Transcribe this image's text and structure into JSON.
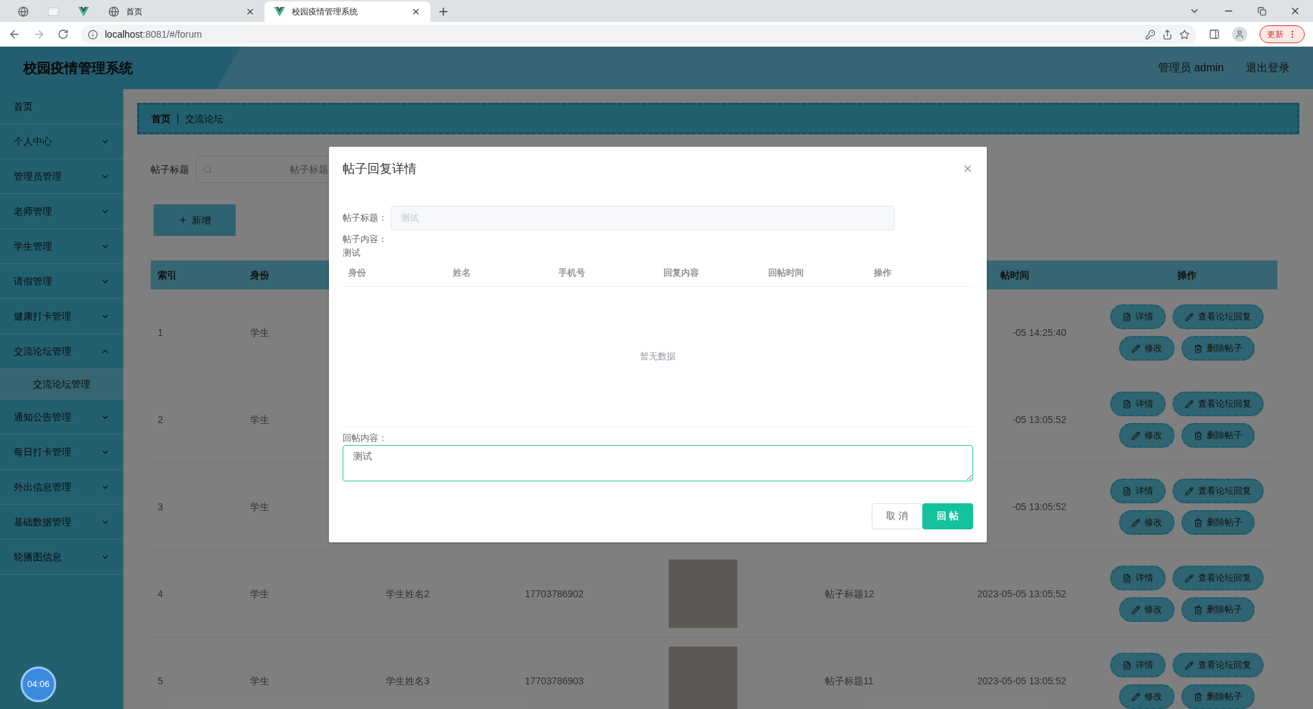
{
  "browser": {
    "tabs": [
      {
        "kind": "globe",
        "selected": false
      },
      {
        "kind": "page",
        "selected": false
      },
      {
        "kind": "vue",
        "selected": false
      },
      {
        "kind": "globe",
        "title": "首页",
        "selected": false
      },
      {
        "kind": "vue",
        "title": "校园疫情管理系统",
        "selected": true
      }
    ],
    "url_host": "localhost",
    "url_rest": ":8081/#/forum",
    "update_button": "更新"
  },
  "header": {
    "title": "校园疫情管理系统",
    "user": "管理员 admin",
    "logout": "退出登录"
  },
  "sidebar": {
    "items": [
      {
        "label": "首页",
        "kind": "link"
      },
      {
        "label": "个人中心",
        "kind": "menu",
        "expanded": false
      },
      {
        "label": "管理员管理",
        "kind": "menu",
        "expanded": false
      },
      {
        "label": "老师管理",
        "kind": "menu",
        "expanded": false
      },
      {
        "label": "学生管理",
        "kind": "menu",
        "expanded": false
      },
      {
        "label": "请假管理",
        "kind": "menu",
        "expanded": false
      },
      {
        "label": "健康打卡管理",
        "kind": "menu",
        "expanded": false
      },
      {
        "label": "交流论坛管理",
        "kind": "menu",
        "expanded": true,
        "children": [
          {
            "label": "交流论坛管理",
            "selected": true
          }
        ]
      },
      {
        "label": "通知公告管理",
        "kind": "menu",
        "expanded": false
      },
      {
        "label": "每日打卡管理",
        "kind": "menu",
        "expanded": false
      },
      {
        "label": "外出信息管理",
        "kind": "menu",
        "expanded": false
      },
      {
        "label": "基础数据管理",
        "kind": "menu",
        "expanded": false
      },
      {
        "label": "轮播图信息",
        "kind": "menu",
        "expanded": false
      }
    ]
  },
  "breadcrumb": [
    "首页",
    "交流论坛"
  ],
  "search": {
    "label": "帖子标题",
    "placeholder": "帖子标题"
  },
  "add_button": "新增",
  "table": {
    "header": {
      "index": "索引",
      "identity": "身份",
      "time": "帖时间",
      "actions": "操作"
    },
    "rows": [
      {
        "index": "1",
        "identity": "学生",
        "time": "-05 14:25:40",
        "actions": [
          {
            "label": "详情",
            "kind": "doc"
          },
          {
            "label": "查看论坛回复",
            "kind": "pencil"
          },
          {
            "label": "修改",
            "kind": "pencil"
          },
          {
            "label": "删除帖子",
            "kind": "trash"
          }
        ]
      },
      {
        "index": "2",
        "identity": "学生",
        "time": "-05 13:05:52",
        "actions": [
          {
            "label": "详情",
            "kind": "doc"
          },
          {
            "label": "查看论坛回复",
            "kind": "pencil"
          },
          {
            "label": "修改",
            "kind": "pencil"
          },
          {
            "label": "删除帖子",
            "kind": "trash"
          }
        ]
      },
      {
        "index": "3",
        "identity": "学生",
        "time": "-05 13:05:52",
        "actions": [
          {
            "label": "详情",
            "kind": "doc"
          },
          {
            "label": "查看论坛回复",
            "kind": "pencil"
          },
          {
            "label": "修改",
            "kind": "pencil"
          },
          {
            "label": "删除帖子",
            "kind": "trash"
          }
        ]
      },
      {
        "index": "4",
        "identity": "学生",
        "name": "学生姓名2",
        "phone": "17703786902",
        "photo": true,
        "title": "帖子标题12",
        "time": "2023-05-05 13:05:52",
        "actions": [
          {
            "label": "详情",
            "kind": "doc"
          },
          {
            "label": "查看论坛回复",
            "kind": "pencil"
          },
          {
            "label": "修改",
            "kind": "pencil"
          },
          {
            "label": "删除帖子",
            "kind": "trash"
          }
        ]
      },
      {
        "index": "5",
        "identity": "学生",
        "name": "学生姓名3",
        "phone": "17703786903",
        "photo": true,
        "title": "帖子标题11",
        "time": "2023-05-05 13:05:52",
        "actions": [
          {
            "label": "详情",
            "kind": "doc"
          },
          {
            "label": "查看论坛回复",
            "kind": "pencil"
          },
          {
            "label": "修改",
            "kind": "pencil"
          },
          {
            "label": "删除帖子",
            "kind": "trash"
          }
        ]
      }
    ]
  },
  "modal": {
    "title": "帖子回复详情",
    "title_label": "帖子标题：",
    "title_value": "测试",
    "content_label": "帖子内容：",
    "content_value": "测试",
    "reply_columns": [
      "身份",
      "姓名",
      "手机号",
      "回复内容",
      "回帖时间",
      "操作"
    ],
    "empty_text": "暂无数据",
    "reply_label": "回帖内容：",
    "reply_value": "测试",
    "cancel_button": "取 消",
    "submit_button": "回 帖"
  },
  "timer": "04:06"
}
